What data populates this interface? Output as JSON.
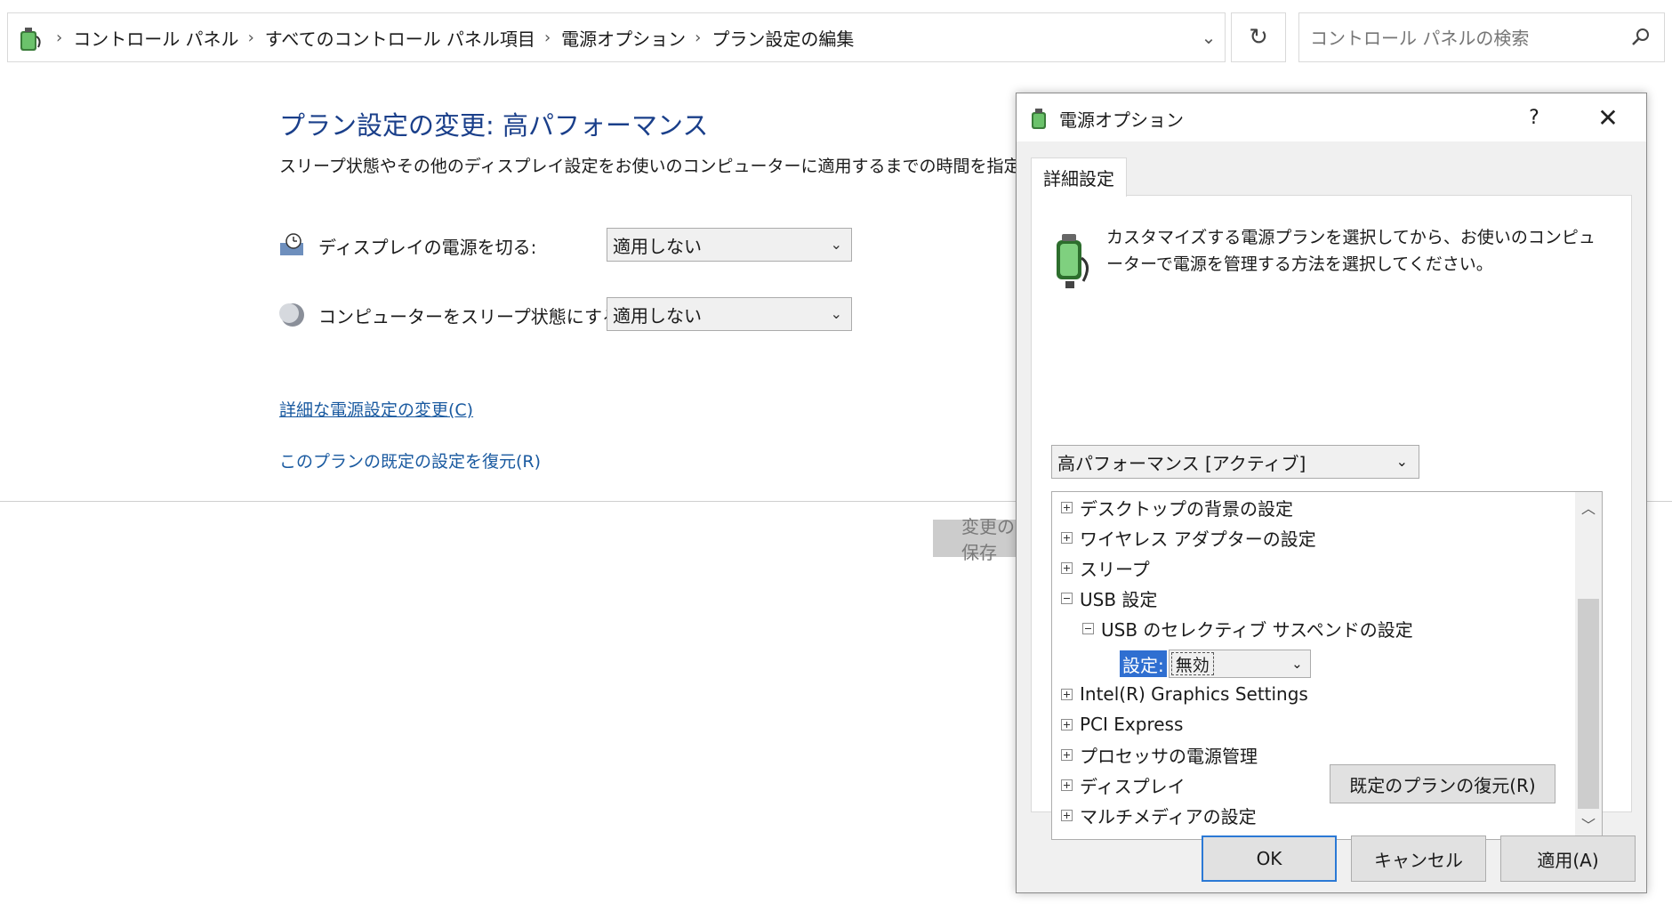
{
  "address_bar": {
    "breadcrumbs": [
      "コントロール パネル",
      "すべてのコントロール パネル項目",
      "電源オプション",
      "プラン設定の編集"
    ],
    "search_placeholder": "コントロール パネルの検索"
  },
  "main": {
    "title": "プラン設定の変更: 高パフォーマンス",
    "description": "スリープ状態やその他のディスプレイ設定をお使いのコンピューターに適用するまでの時間を指定してください。",
    "settings": [
      {
        "label": "ディスプレイの電源を切る:",
        "value": "適用しない",
        "icon": "monitor-clock-icon"
      },
      {
        "label": "コンピューターをスリープ状態にする:",
        "value": "適用しない",
        "icon": "moon-icon"
      }
    ],
    "link_advanced": "詳細な電源設定の変更(C)",
    "link_restore": "このプランの既定の設定を復元(R)",
    "save_button": "変更の保存"
  },
  "dialog": {
    "title": "電源オプション",
    "help": "?",
    "close": "✕",
    "tab": "詳細設定",
    "description": "カスタマイズする電源プランを選択してから、お使いのコンピューターで電源を管理する方法を選択してください。",
    "plan": "高パフォーマンス [アクティブ]",
    "tree": [
      {
        "label": "デスクトップの背景の設定",
        "expanded": false
      },
      {
        "label": "ワイヤレス アダプターの設定",
        "expanded": false
      },
      {
        "label": "スリープ",
        "expanded": false
      },
      {
        "label": "USB 設定",
        "expanded": true
      },
      {
        "label": "USB のセレクティブ サスペンドの設定",
        "expanded": true
      },
      {
        "label": "Intel(R) Graphics Settings",
        "expanded": false
      },
      {
        "label": "PCI Express",
        "expanded": false
      },
      {
        "label": "プロセッサの電源管理",
        "expanded": false
      },
      {
        "label": "ディスプレイ",
        "expanded": false
      },
      {
        "label": "マルチメディアの設定",
        "expanded": false
      }
    ],
    "setting_key": "設定:",
    "setting_value": "無効",
    "restore_plan_button": "既定のプランの復元(R)",
    "ok": "OK",
    "cancel": "キャンセル",
    "apply": "適用(A)"
  },
  "colors": {
    "title_blue": "#1a3f8a",
    "link_blue": "#1a5aa0",
    "selection_blue": "#2f6fd1",
    "default_button_border": "#2b79d5"
  }
}
